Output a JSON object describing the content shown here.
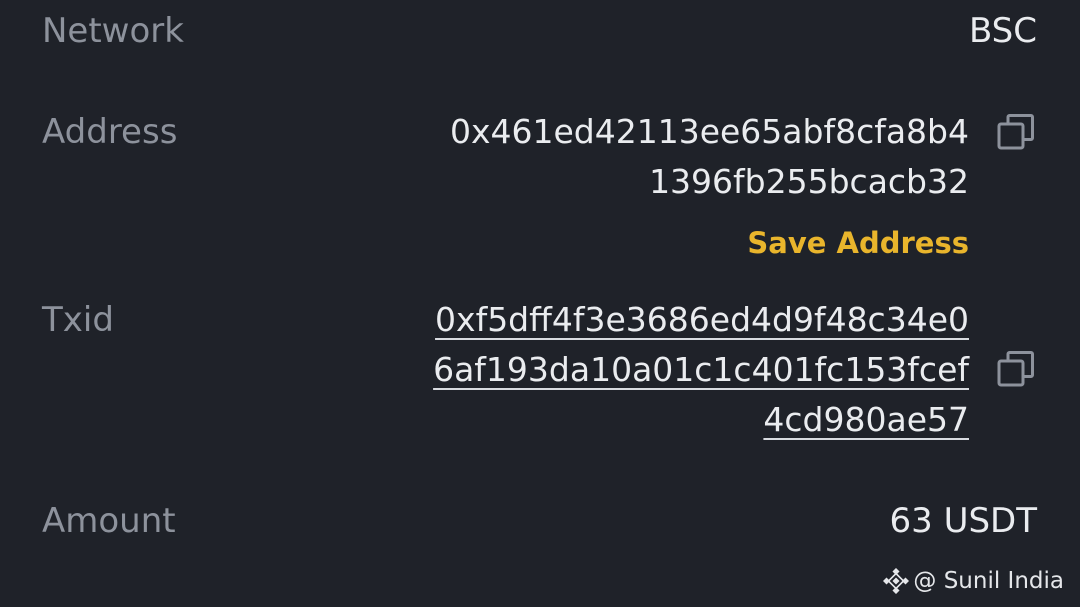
{
  "rows": {
    "network": {
      "label": "Network",
      "value": "BSC"
    },
    "address": {
      "label": "Address",
      "value_lines": [
        "0x461ed42113ee65abf8cfa8b4",
        "1396fb255bcacb32"
      ],
      "save_label": "Save Address",
      "copy_icon": "copy-icon"
    },
    "txid": {
      "label": "Txid",
      "value_lines": [
        "0xf5dff4f3e3686ed4d9f48c34e0",
        "6af193da10a01c1c401fc153fcef",
        "4cd980ae57"
      ],
      "copy_icon": "copy-icon"
    },
    "amount": {
      "label": "Amount",
      "value": "63 USDT"
    }
  },
  "watermark": {
    "icon": "binance-logo-icon",
    "text": "@ Sunil India"
  },
  "colors": {
    "background": "#1f2229",
    "label": "#8d929c",
    "value": "#eaecef",
    "accent": "#e9b52c"
  }
}
